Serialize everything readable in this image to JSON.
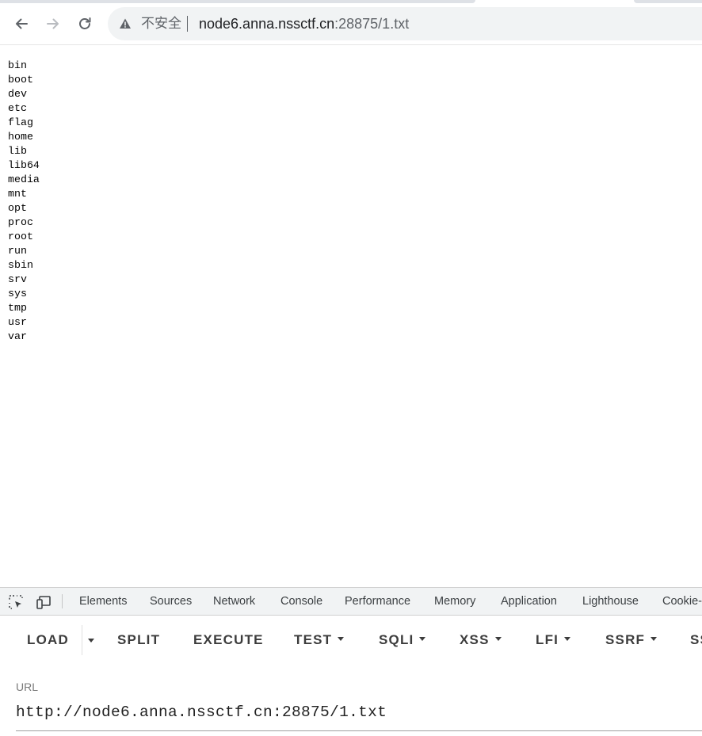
{
  "browser": {
    "security_label": "不安全",
    "url_host": "node6.anna.nssctf.cn",
    "url_path": ":28875/1.txt"
  },
  "page": {
    "lines": [
      "bin",
      "boot",
      "dev",
      "etc",
      "flag",
      "home",
      "lib",
      "lib64",
      "media",
      "mnt",
      "opt",
      "proc",
      "root",
      "run",
      "sbin",
      "srv",
      "sys",
      "tmp",
      "usr",
      "var"
    ]
  },
  "devtools": {
    "tabs": [
      "Elements",
      "Sources",
      "Network",
      "Console",
      "Performance",
      "Memory",
      "Application",
      "Lighthouse",
      "Cookie-"
    ]
  },
  "hackbar": {
    "buttons": {
      "load": "LOAD",
      "split": "SPLIT",
      "execute": "EXECUTE",
      "test": "TEST",
      "sqli": "SQLI",
      "xss": "XSS",
      "lfi": "LFI",
      "ssrf": "SSRF",
      "more": "SS"
    },
    "url_label": "URL",
    "url_value": "http://node6.anna.nssctf.cn:28875/1.txt"
  }
}
